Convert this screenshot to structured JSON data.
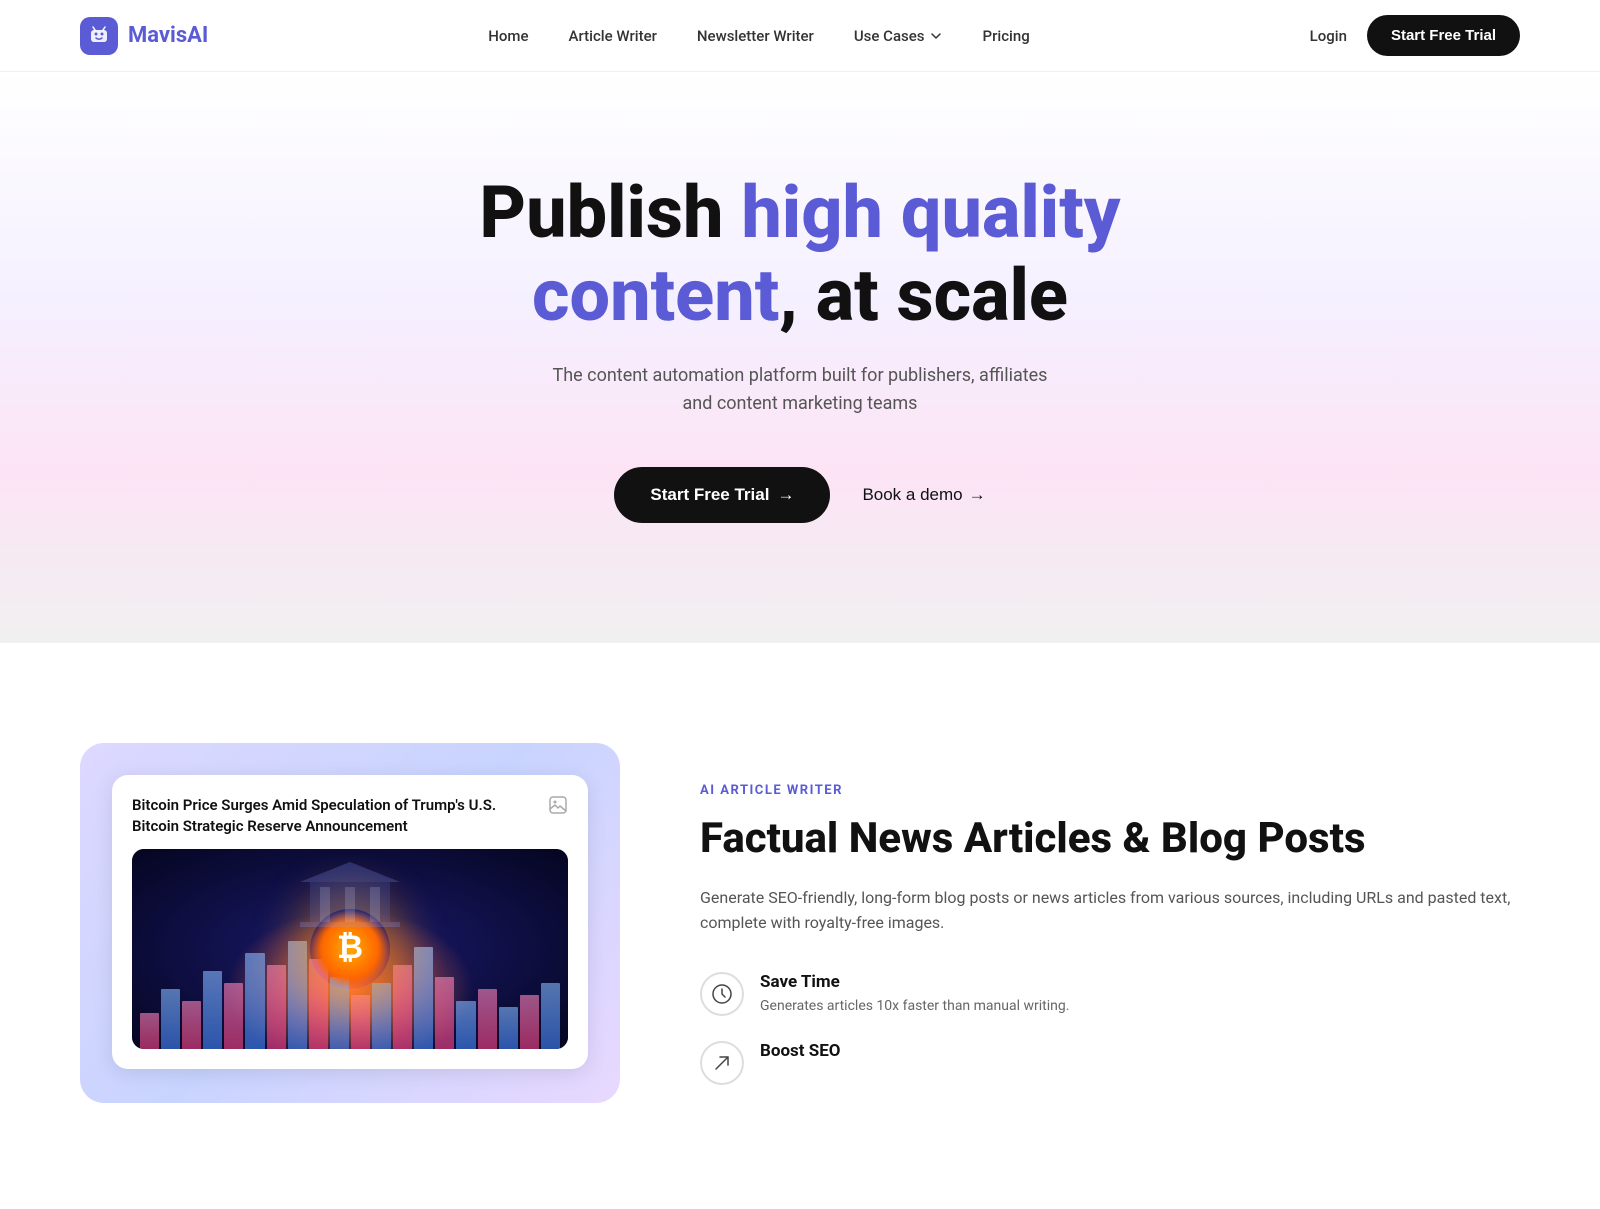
{
  "brand": {
    "name": "Mavis",
    "name_accent": "AI",
    "logo_icon": "🤖"
  },
  "nav": {
    "links": [
      {
        "label": "Home",
        "id": "home"
      },
      {
        "label": "Article Writer",
        "id": "article-writer"
      },
      {
        "label": "Newsletter Writer",
        "id": "newsletter-writer"
      },
      {
        "label": "Use Cases",
        "id": "use-cases",
        "has_dropdown": true
      },
      {
        "label": "Pricing",
        "id": "pricing"
      }
    ],
    "login_label": "Login",
    "cta_label": "Start Free Trial"
  },
  "hero": {
    "headline_part1": "Publish ",
    "headline_accent": "high quality content",
    "headline_part2": ", at scale",
    "subheadline": "The content automation platform built for publishers, affiliates and content marketing teams",
    "cta_primary": "Start Free Trial",
    "cta_secondary": "Book a demo"
  },
  "feature_section": {
    "label": "AI ARTICLE WRITER",
    "title": "Factual News Articles & Blog Posts",
    "description": "Generate SEO-friendly, long-form blog posts or news articles from various sources, including URLs and pasted text, complete with royalty-free images.",
    "points": [
      {
        "icon": "⏱",
        "title": "Save Time",
        "desc": "Generates articles 10x faster than manual writing."
      },
      {
        "icon": "↗",
        "title": "Boost SEO",
        "desc": ""
      }
    ],
    "article_title": "Bitcoin Price Surges Amid Speculation of Trump's U.S. Bitcoin Strategic Reserve Announcement"
  }
}
